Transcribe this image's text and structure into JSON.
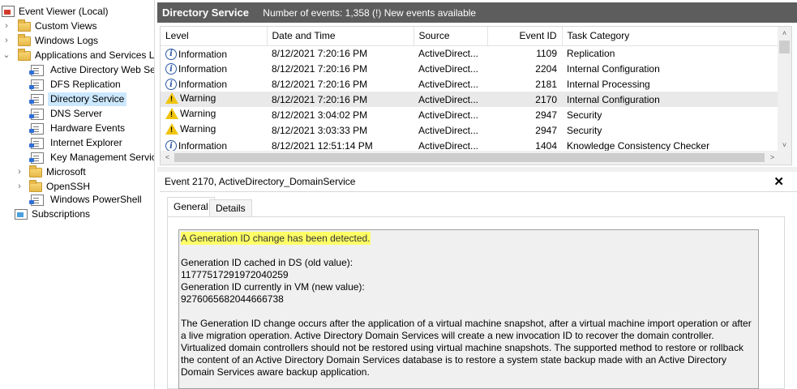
{
  "tree": {
    "items": [
      {
        "label": "Event Viewer (Local)"
      },
      {
        "label": "Custom Views"
      },
      {
        "label": "Windows Logs"
      },
      {
        "label": "Applications and Services Lo"
      },
      {
        "label": "Active Directory Web Ser"
      },
      {
        "label": "DFS Replication"
      },
      {
        "label": "Directory Service"
      },
      {
        "label": "DNS Server"
      },
      {
        "label": "Hardware Events"
      },
      {
        "label": "Internet Explorer"
      },
      {
        "label": "Key Management Service"
      },
      {
        "label": "Microsoft"
      },
      {
        "label": "OpenSSH"
      },
      {
        "label": "Windows PowerShell"
      },
      {
        "label": "Subscriptions"
      }
    ]
  },
  "header": {
    "title": "Directory Service",
    "info": "Number of events: 1,358 (!) New events available"
  },
  "events": {
    "columns": [
      "Level",
      "Date and Time",
      "Source",
      "Event ID",
      "Task Category"
    ],
    "rows": [
      {
        "level": "Information",
        "date": "8/12/2021 7:20:16 PM",
        "source": "ActiveDirect...",
        "id": "1109",
        "category": "Replication"
      },
      {
        "level": "Information",
        "date": "8/12/2021 7:20:16 PM",
        "source": "ActiveDirect...",
        "id": "2204",
        "category": "Internal Configuration"
      },
      {
        "level": "Information",
        "date": "8/12/2021 7:20:16 PM",
        "source": "ActiveDirect...",
        "id": "2181",
        "category": "Internal Processing"
      },
      {
        "level": "Warning",
        "date": "8/12/2021 7:20:16 PM",
        "source": "ActiveDirect...",
        "id": "2170",
        "category": "Internal Configuration"
      },
      {
        "level": "Warning",
        "date": "8/12/2021 3:04:02 PM",
        "source": "ActiveDirect...",
        "id": "2947",
        "category": "Security"
      },
      {
        "level": "Warning",
        "date": "8/12/2021 3:03:33 PM",
        "source": "ActiveDirect...",
        "id": "2947",
        "category": "Security"
      },
      {
        "level": "Information",
        "date": "8/12/2021 12:51:14 PM",
        "source": "ActiveDirect...",
        "id": "1404",
        "category": "Knowledge Consistency Checker"
      }
    ]
  },
  "detail": {
    "title": "Event 2170, ActiveDirectory_DomainService",
    "close": "✕",
    "tabs": [
      "General",
      "Details"
    ],
    "highlight": "A Generation ID change has been detected.",
    "body": "\n\nGeneration ID cached in DS (old value):\n11777517291972040259\nGeneration ID currently in VM (new value):\n9276065682044666738\n\nThe Generation ID change occurs after the application of a virtual machine snapshot, after a virtual machine import operation or after a live migration operation. Active Directory Domain Services will create a new invocation ID to recover the domain controller. Virtualized domain controllers should not be restored using virtual machine snapshots. The supported method to restore or rollback the content of an Active Directory Domain Services database is to restore a system state backup made with an Active Directory Domain Services aware backup application."
  }
}
